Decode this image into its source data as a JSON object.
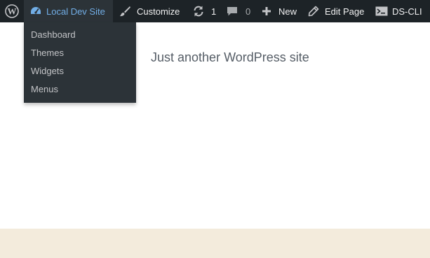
{
  "admin_bar": {
    "wp_logo_icon": "wordpress-logo-icon",
    "site_name": {
      "icon": "dashboard-gauge-icon",
      "label": "Local Dev Site",
      "color": "#72aee6"
    },
    "customize": {
      "icon": "paintbrush-icon",
      "label": "Customize"
    },
    "updates": {
      "icon": "refresh-icon",
      "count": "1"
    },
    "comments": {
      "icon": "speech-bubble-icon",
      "count": "0"
    },
    "new": {
      "icon": "plus-icon",
      "label": "New"
    },
    "edit_page": {
      "icon": "pencil-icon",
      "label": "Edit Page"
    },
    "ds_cli": {
      "icon": "terminal-icon",
      "label": "DS-CLI"
    },
    "background_color": "#1d2327"
  },
  "site_menu": {
    "items": [
      {
        "label": "Dashboard"
      },
      {
        "label": "Themes"
      },
      {
        "label": "Widgets"
      },
      {
        "label": "Menus"
      }
    ]
  },
  "page": {
    "tagline": "Just another WordPress site",
    "footer_color": "#f3ebdc"
  }
}
